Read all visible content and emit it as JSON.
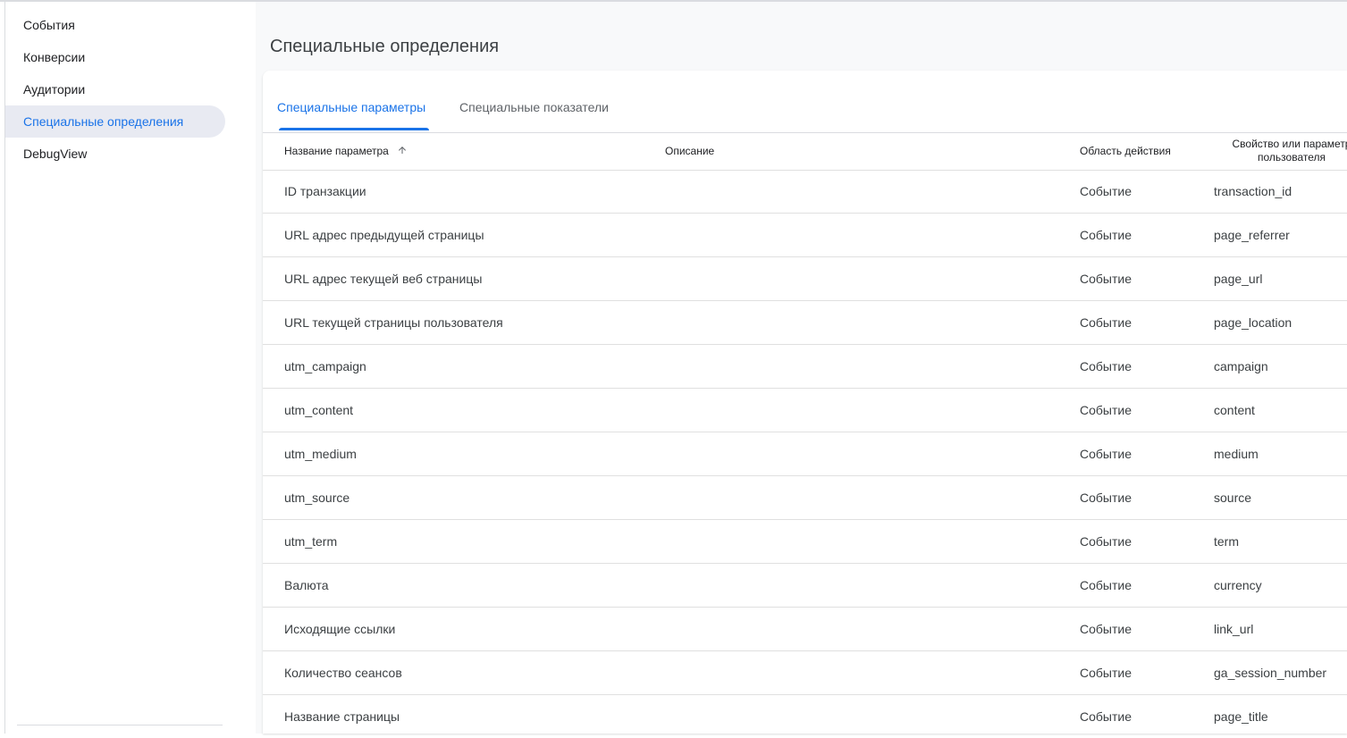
{
  "sidebar": {
    "items": [
      {
        "label": "События"
      },
      {
        "label": "Конверсии"
      },
      {
        "label": "Аудитории"
      },
      {
        "label": "Специальные определения",
        "active": true
      },
      {
        "label": "DebugView"
      }
    ]
  },
  "page": {
    "title": "Специальные определения"
  },
  "tabs": [
    {
      "label": "Специальные параметры",
      "active": true
    },
    {
      "label": "Специальные показатели"
    }
  ],
  "table": {
    "columns": {
      "name": "Название параметра",
      "description": "Описание",
      "scope": "Область действия",
      "property_line1": "Свойство или параметр",
      "property_line2": "пользователя"
    },
    "sort": {
      "column": "name",
      "direction": "ascending",
      "icon": "arrow-upward-icon"
    },
    "rows": [
      {
        "name": "ID транзакции",
        "description": "",
        "scope": "Событие",
        "param": "transaction_id"
      },
      {
        "name": "URL адрес предыдущей страницы",
        "description": "",
        "scope": "Событие",
        "param": "page_referrer"
      },
      {
        "name": "URL адрес текущей веб страницы",
        "description": "",
        "scope": "Событие",
        "param": "page_url"
      },
      {
        "name": "URL текущей страницы пользователя",
        "description": "",
        "scope": "Событие",
        "param": "page_location"
      },
      {
        "name": "utm_campaign",
        "description": "",
        "scope": "Событие",
        "param": "campaign"
      },
      {
        "name": "utm_content",
        "description": "",
        "scope": "Событие",
        "param": "content"
      },
      {
        "name": "utm_medium",
        "description": "",
        "scope": "Событие",
        "param": "medium"
      },
      {
        "name": "utm_source",
        "description": "",
        "scope": "Событие",
        "param": "source"
      },
      {
        "name": "utm_term",
        "description": "",
        "scope": "Событие",
        "param": "term"
      },
      {
        "name": "Валюта",
        "description": "",
        "scope": "Событие",
        "param": "currency"
      },
      {
        "name": "Исходящие ссылки",
        "description": "",
        "scope": "Событие",
        "param": "link_url"
      },
      {
        "name": "Количество сеансов",
        "description": "",
        "scope": "Событие",
        "param": "ga_session_number"
      },
      {
        "name": "Название страницы",
        "description": "",
        "scope": "Событие",
        "param": "page_title"
      }
    ]
  },
  "colors": {
    "accent": "#1a73e8",
    "active_nav_bg": "#e8eaf2",
    "page_bg": "#f8f9fa",
    "divider": "#dadce0"
  }
}
